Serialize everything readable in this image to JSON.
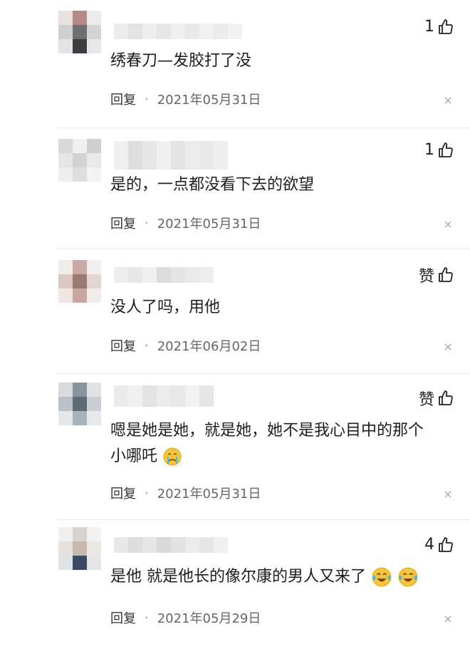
{
  "comments": [
    {
      "text": "绣春刀—发胶打了没",
      "date": "2021年05月31日",
      "likes": "1",
      "reply": "回复"
    },
    {
      "text": "是的，一点都没看下去的欲望",
      "date": "2021年05月31日",
      "likes": "1",
      "reply": "回复"
    },
    {
      "text": "没人了吗，用他",
      "date": "2021年06月02日",
      "likes": "赞",
      "reply": "回复"
    },
    {
      "text_line1": "嗯是她是她，就是她，她不是我心目中的那个",
      "text_line2": "小哪吒",
      "date": "2021年05月31日",
      "likes": "赞",
      "reply": "回复"
    },
    {
      "text": "是他 就是他长的像尔康的男人又来了",
      "date": "2021年05月29日",
      "likes": "4",
      "reply": "回复"
    }
  ],
  "icons": {
    "like": "thumbs-up-icon",
    "close": "close-icon",
    "emoji": "crying-laughing-emoji-icon"
  },
  "separator": "·"
}
